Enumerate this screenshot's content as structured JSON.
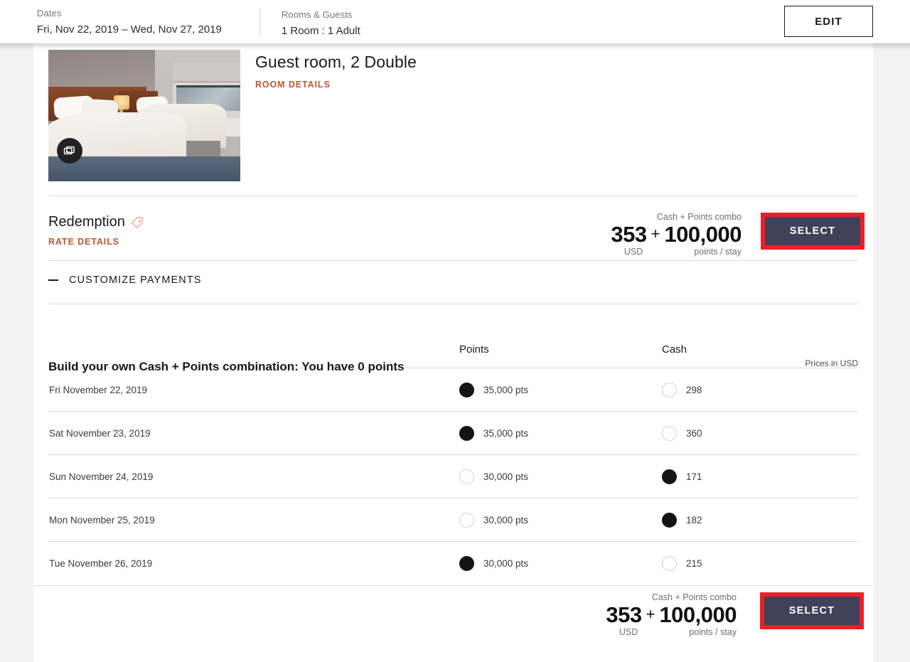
{
  "header": {
    "dates_label": "Dates",
    "dates_value": "Fri, Nov 22, 2019 – Wed, Nov 27, 2019",
    "rooms_label": "Rooms & Guests",
    "rooms_value": "1 Room : 1 Adult",
    "edit_label": "EDIT"
  },
  "room": {
    "title": "Guest room, 2 Double",
    "details_link": "ROOM DETAILS",
    "photo_badge_icon": "photo-gallery-icon"
  },
  "rate": {
    "name": "Redemption",
    "tag_icon": "price-tag-icon",
    "details_link": "RATE DETAILS",
    "combo_label": "Cash + Points combo",
    "cash": "353",
    "plus": "+",
    "points": "100,000",
    "cash_unit": "USD",
    "points_unit": "points / stay",
    "select_label": "SELECT"
  },
  "customize": {
    "toggle_icon": "minus-icon",
    "label": "CUSTOMIZE PAYMENTS"
  },
  "build": {
    "heading": "Build your own Cash + Points combination: You have 0 points",
    "prices_note": "Prices in USD",
    "columns": [
      "",
      "Points",
      "Cash"
    ],
    "rows": [
      {
        "date": "Fri November 22, 2019",
        "points": "35,000 pts",
        "points_selected": true,
        "cash": "298",
        "cash_selected": false
      },
      {
        "date": "Sat November 23, 2019",
        "points": "35,000 pts",
        "points_selected": true,
        "cash": "360",
        "cash_selected": false
      },
      {
        "date": "Sun November 24, 2019",
        "points": "30,000 pts",
        "points_selected": false,
        "cash": "171",
        "cash_selected": true
      },
      {
        "date": "Mon November 25, 2019",
        "points": "30,000 pts",
        "points_selected": false,
        "cash": "182",
        "cash_selected": true
      },
      {
        "date": "Tue November 26, 2019",
        "points": "30,000 pts",
        "points_selected": true,
        "cash": "215",
        "cash_selected": false
      }
    ]
  },
  "footer": {
    "combo_label": "Cash + Points combo",
    "cash": "353",
    "plus": "+",
    "points": "100,000",
    "cash_unit": "USD",
    "points_unit": "points / stay",
    "select_label": "SELECT"
  },
  "colors": {
    "accent_red": "#ec1f27",
    "select_fill": "#41415a",
    "link_orange": "#c05434",
    "tag_icon": "#f08a6e"
  }
}
